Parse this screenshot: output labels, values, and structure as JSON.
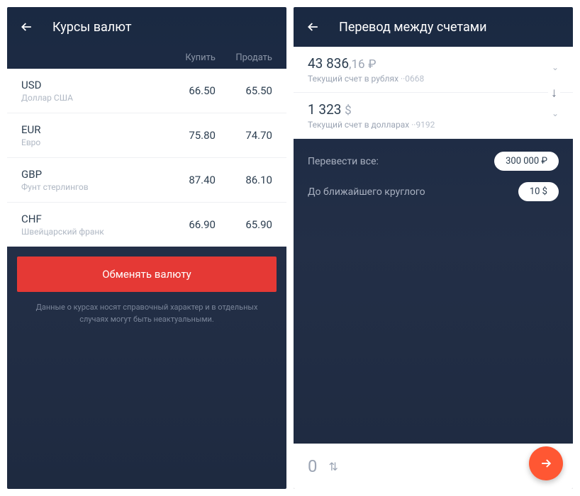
{
  "left": {
    "title": "Курсы валют",
    "columns": {
      "buy": "Купить",
      "sell": "Продать"
    },
    "rates": [
      {
        "code": "USD",
        "name": "Доллар США",
        "buy": "66.50",
        "sell": "65.50"
      },
      {
        "code": "EUR",
        "name": "Евро",
        "buy": "75.80",
        "sell": "74.70"
      },
      {
        "code": "GBP",
        "name": "Фунт стерлингов",
        "buy": "87.40",
        "sell": "86.10"
      },
      {
        "code": "CHF",
        "name": "Швейцарский франк",
        "buy": "66.90",
        "sell": "65.90"
      }
    ],
    "exchange_button": "Обменять валюту",
    "disclaimer": "Данные о курсах носят справочный характер и в отдельных случаях могут быть неактуальными."
  },
  "right": {
    "title": "Перевод между счетами",
    "from": {
      "amount_int": "43 836",
      "amount_dec": ",16",
      "currency": "₽",
      "label": "Текущий счет в рублях",
      "masked": "··0668"
    },
    "to": {
      "amount_int": "1 323",
      "amount_dec": "",
      "currency": "$",
      "label": "Текущий счет в долларах",
      "masked": "··9192"
    },
    "options": [
      {
        "label": "Перевести все:",
        "value": "300 000 ₽"
      },
      {
        "label": "До ближайшего круглого",
        "value": "10 $"
      }
    ],
    "input_amount": "0"
  }
}
